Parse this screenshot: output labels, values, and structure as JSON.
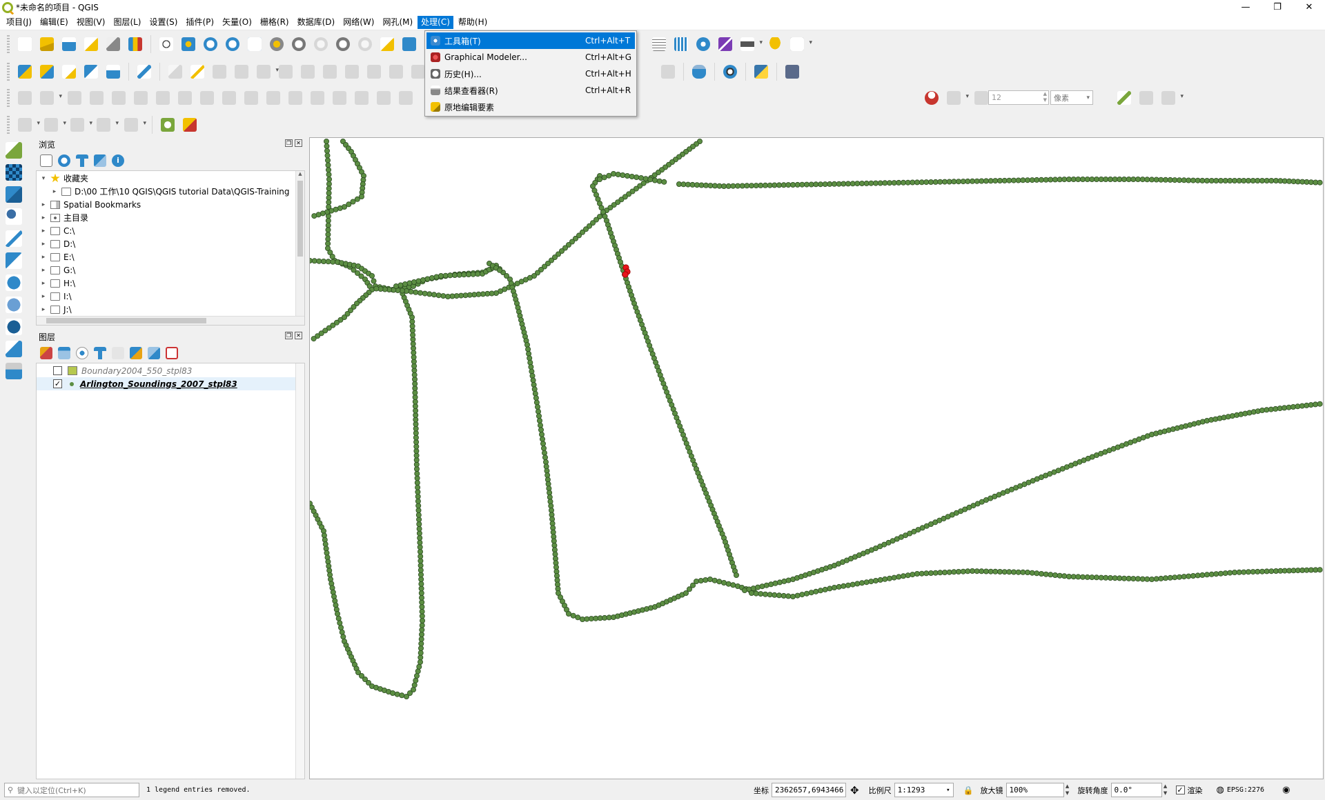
{
  "window": {
    "title": "*未命名的项目 - QGIS",
    "minimize": "—",
    "maximize": "❐",
    "close": "✕"
  },
  "menubar": [
    "项目(J)",
    "编辑(E)",
    "视图(V)",
    "图层(L)",
    "设置(S)",
    "插件(P)",
    "矢量(O)",
    "栅格(R)",
    "数据库(D)",
    "网络(W)",
    "网孔(M)",
    "处理(C)",
    "帮助(H)"
  ],
  "menubar_active": "处理(C)",
  "processing_menu": [
    {
      "label": "工具箱(T)",
      "shortcut": "Ctrl+Alt+T",
      "icon": "gear-icon",
      "highlighted": true
    },
    {
      "label": "Graphical Modeler...",
      "shortcut": "Ctrl+Alt+G",
      "icon": "modeler-icon",
      "highlighted": false
    },
    {
      "label": "历史(H)...",
      "shortcut": "Ctrl+Alt+H",
      "icon": "history-icon",
      "highlighted": false
    },
    {
      "label": "结果查看器(R)",
      "shortcut": "Ctrl+Alt+R",
      "icon": "results-icon",
      "highlighted": false
    },
    {
      "label": "原地编辑要素",
      "shortcut": "",
      "icon": "edit-in-place-icon",
      "highlighted": false
    }
  ],
  "snapping": {
    "tolerance": "12",
    "unit": "像素"
  },
  "browser_panel": {
    "title": "浏览",
    "items": [
      {
        "label": "收藏夹",
        "indent": 0,
        "expanded": true,
        "icon": "star-icon"
      },
      {
        "label": "D:\\00 工作\\10 QGIS\\QGIS tutorial Data\\QGIS-Training",
        "indent": 1,
        "expanded": false,
        "icon": "folder-icon"
      },
      {
        "label": "Spatial Bookmarks",
        "indent": 0,
        "expanded": false,
        "icon": "bookmark-icon"
      },
      {
        "label": "主目录",
        "indent": 0,
        "expanded": false,
        "icon": "home-icon"
      },
      {
        "label": "C:\\",
        "indent": 0,
        "expanded": false,
        "icon": "folder-icon"
      },
      {
        "label": "D:\\",
        "indent": 0,
        "expanded": false,
        "icon": "folder-icon"
      },
      {
        "label": "E:\\",
        "indent": 0,
        "expanded": false,
        "icon": "folder-icon"
      },
      {
        "label": "G:\\",
        "indent": 0,
        "expanded": false,
        "icon": "folder-icon"
      },
      {
        "label": "H:\\",
        "indent": 0,
        "expanded": false,
        "icon": "folder-icon"
      },
      {
        "label": "I:\\",
        "indent": 0,
        "expanded": false,
        "icon": "folder-icon"
      },
      {
        "label": "J:\\",
        "indent": 0,
        "expanded": false,
        "icon": "folder-icon"
      }
    ]
  },
  "layers_panel": {
    "title": "图层",
    "layers": [
      {
        "name": "Boundary2004_550_stpl83",
        "checked": false,
        "style": "polygon",
        "color": "#b6c84f"
      },
      {
        "name": "Arlington_Soundings_2007_stpl83",
        "checked": true,
        "style": "point",
        "color": "#5c8e43"
      }
    ]
  },
  "map": {
    "point_color": "#5c8e43",
    "point_stroke": "#2b4a20",
    "selected_color": "#e8151b"
  },
  "statusbar": {
    "locate_placeholder": "键入以定位(Ctrl+K)",
    "message": "1 legend entries removed.",
    "coord_label": "坐标",
    "coord_value": "2362657,6943466",
    "scale_label": "比例尺",
    "scale_value": "1:1293",
    "magnifier_label": "放大镜",
    "magnifier_value": "100%",
    "rotation_label": "旋转角度",
    "rotation_value": "0.0°",
    "render_label": "渲染",
    "render_checked": true,
    "crs": "EPSG:2276"
  }
}
